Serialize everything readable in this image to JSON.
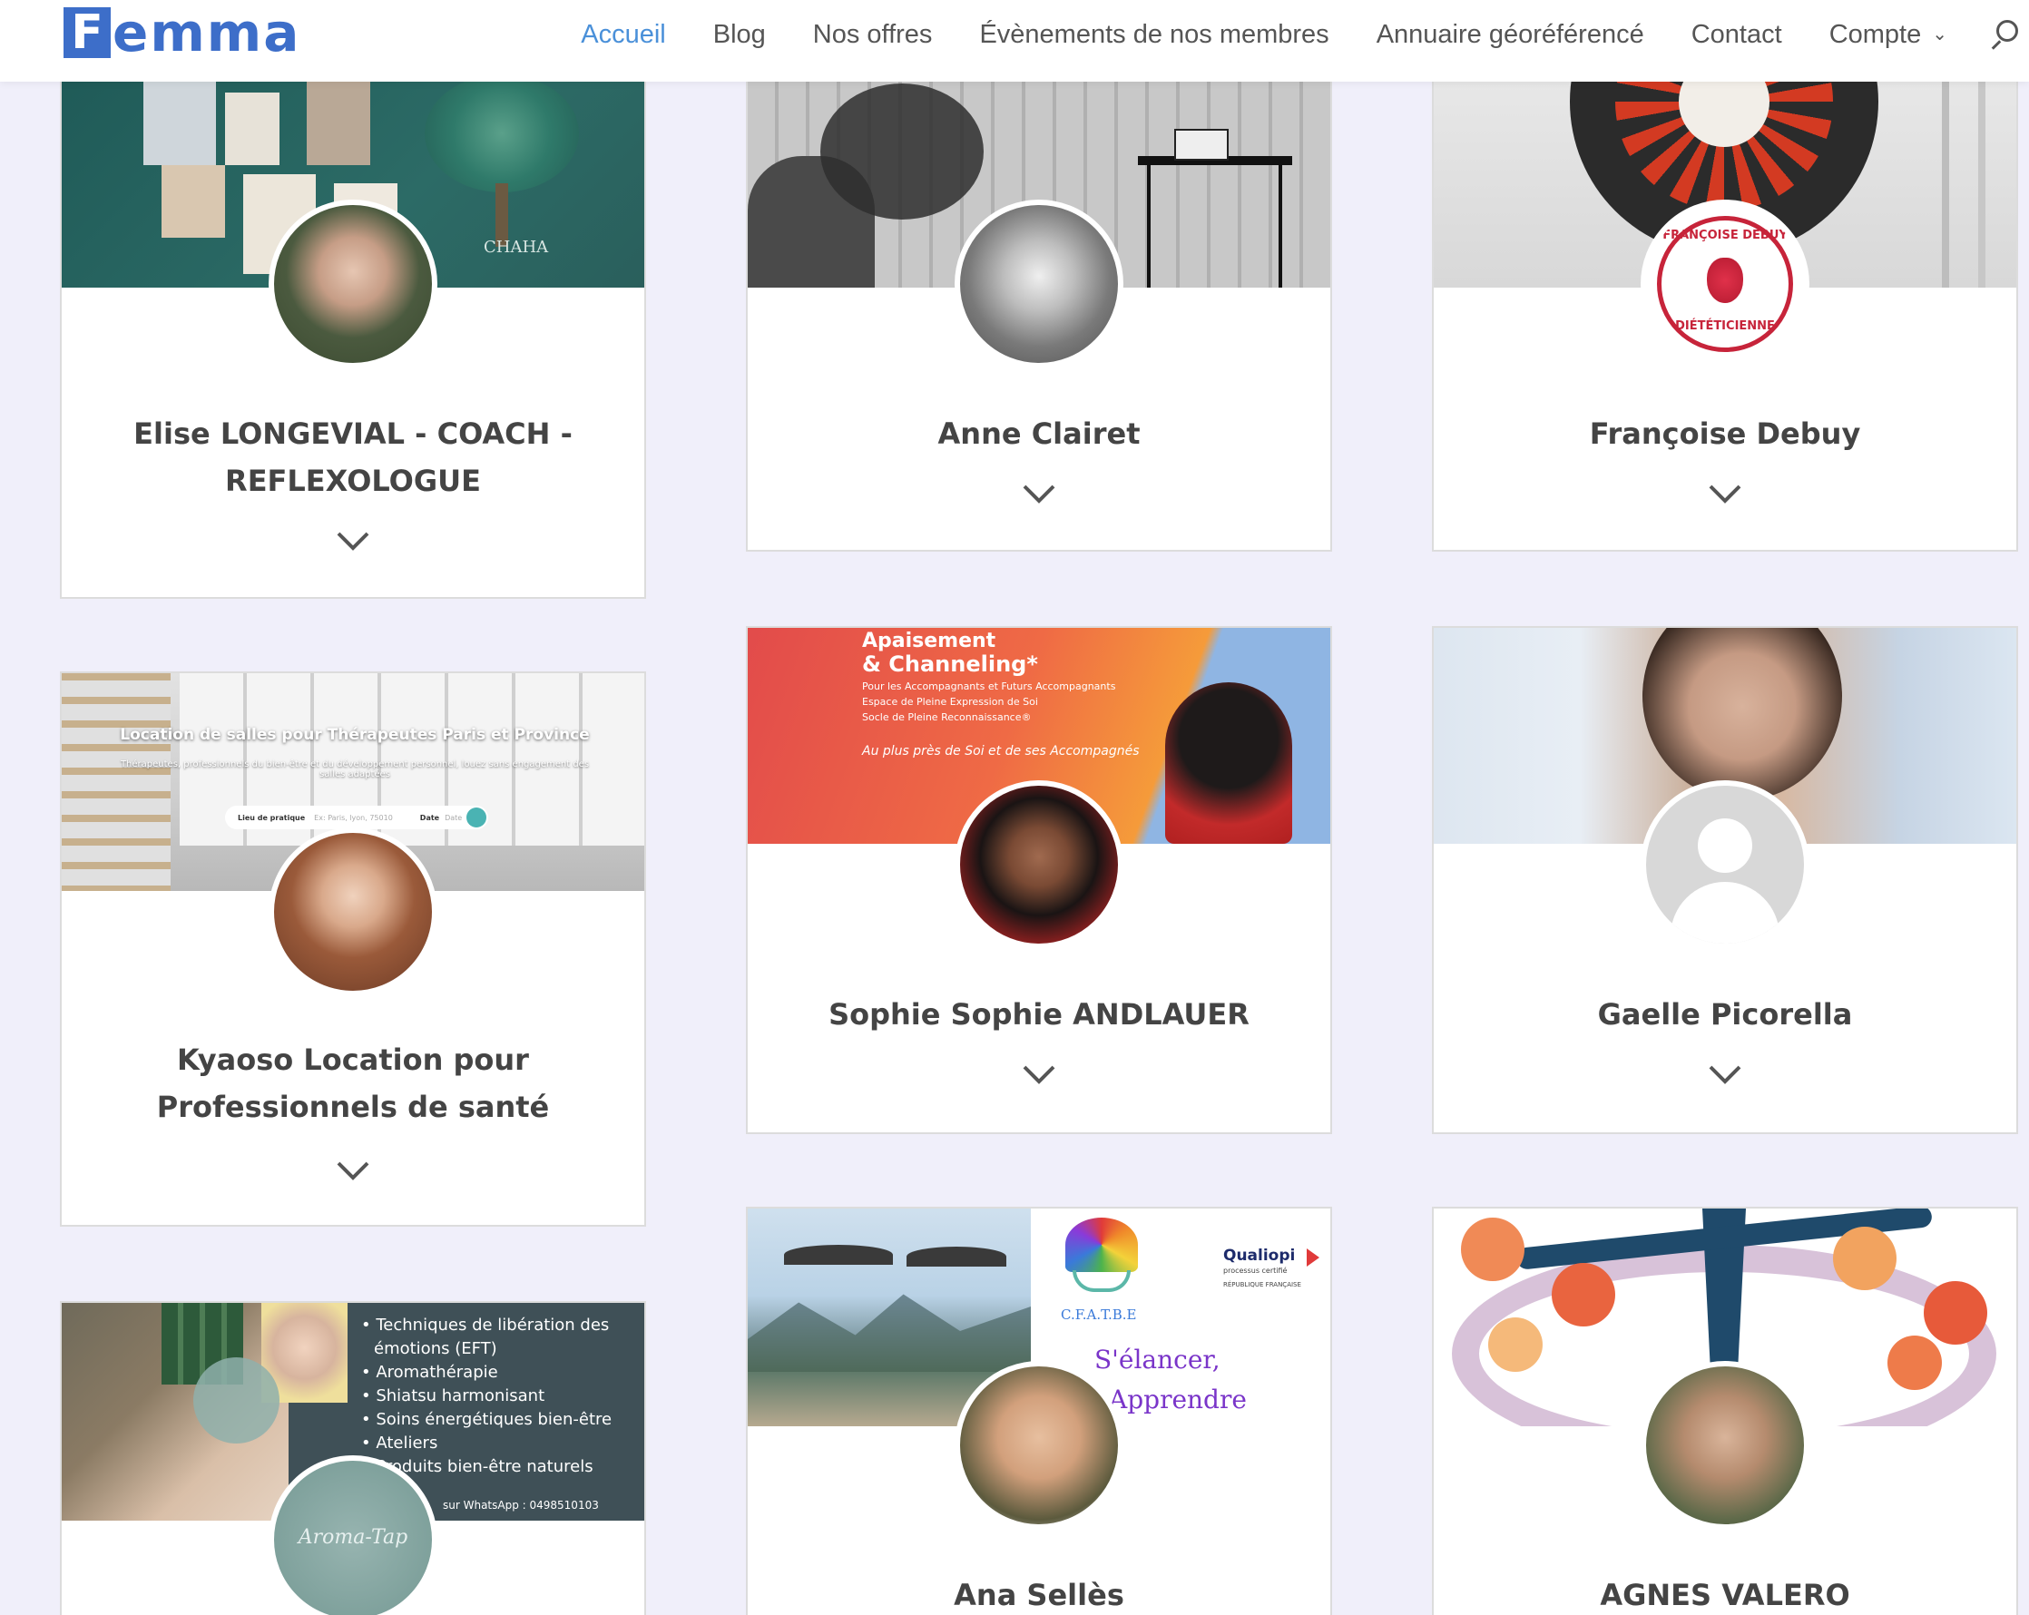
{
  "header": {
    "logo_initial": "F",
    "logo_rest": "emma",
    "nav": [
      {
        "label": "Accueil",
        "active": true
      },
      {
        "label": "Blog"
      },
      {
        "label": "Nos offres"
      },
      {
        "label": "Évènements de nos membres"
      },
      {
        "label": "Annuaire géoréférencé"
      },
      {
        "label": "Contact"
      },
      {
        "label": "Compte",
        "dropdown": true
      }
    ]
  },
  "cards": [
    {
      "name": "Elise LONGEVIAL - COACH - REFLEXOLOGUE",
      "banner_text": "CHAHA"
    },
    {
      "name": "Anne Clairet"
    },
    {
      "name": "Françoise Debuy",
      "logo_text_top": "FRANÇOISE DEBUY",
      "logo_text_bottom": "DIÉTÉTICIENNE"
    },
    {
      "name": "Kyaoso Location pour Professionnels de santé",
      "banner_title": "Location de salles pour Thérapeutes Paris et Province",
      "banner_sub": "Thérapeutes, professionnels du bien-être et du développement personnel, louez sans engagement des salles adaptées",
      "search_label_1": "Lieu de pratique",
      "search_placeholder": "Ex: Paris, lyon, 75010",
      "search_label_2": "Date",
      "search_placeholder_2": "Date"
    },
    {
      "name": "Sophie Sophie ANDLAUER",
      "banner_title_1": "Apaisement",
      "banner_title_2": "& Channeling*",
      "banner_line_1": "Pour les Accompagnants et Futurs Accompagnants",
      "banner_line_2": "Espace de Pleine Expression de Soi",
      "banner_line_3": "Socle de Pleine Reconnaissance®",
      "banner_tagline": "Au plus près de Soi et de ses Accompagnés"
    },
    {
      "name": "Gaelle Picorella"
    },
    {
      "name": "",
      "banner_items": [
        "• Techniques de libération des",
        "  émotions (EFT)",
        "• Aromathérapie",
        "• Shiatsu harmonisant",
        "• Soins énergétiques bien-être",
        "• Ateliers",
        "• Produits bien-être naturels"
      ],
      "banner_footer": "sur WhatsApp : 0498510103",
      "logo_text": "Aroma-Tap"
    },
    {
      "name": "Ana Sellès",
      "org": "C.F.A.T.B.E",
      "qualiopi": "Qualiopi",
      "qualiopi_sub": "processus certifié",
      "qualiopi_rep": "RÉPUBLIQUE FRANÇAISE",
      "slogan_1": "S'élancer,",
      "slogan_2": "Apprendre"
    },
    {
      "name": "AGNES VALERO"
    }
  ]
}
